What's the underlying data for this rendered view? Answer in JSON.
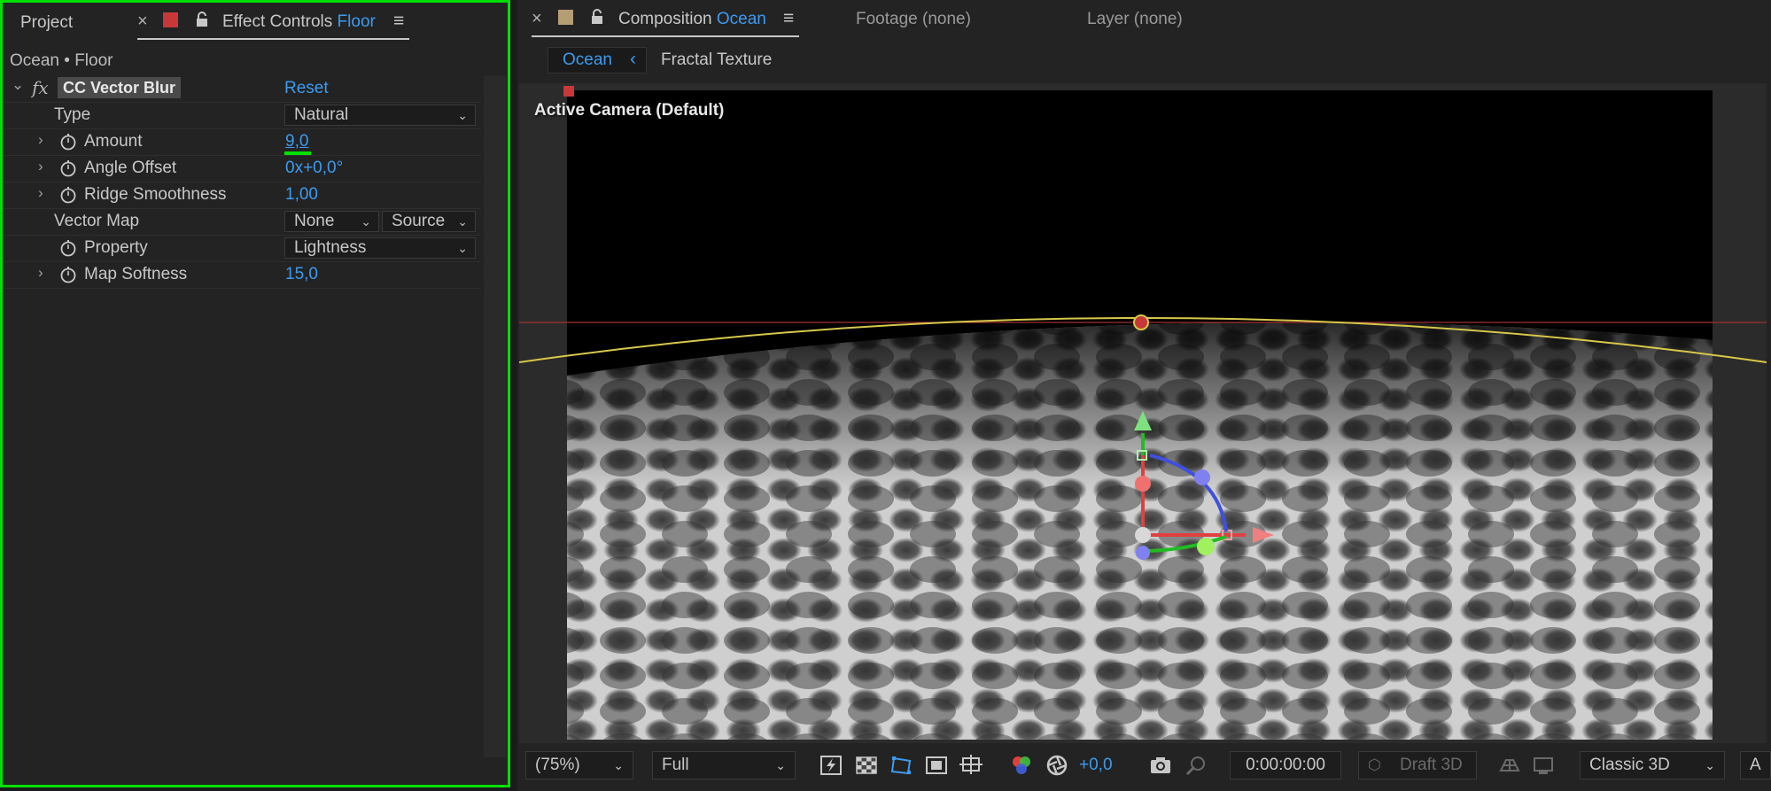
{
  "left_tabs": {
    "project": "Project",
    "close": "×",
    "effect_controls": "Effect Controls",
    "effect_layer": "Floor",
    "menu": "≡"
  },
  "breadcrumb": "Ocean • Floor",
  "effect": {
    "name": "CC Vector Blur",
    "reset": "Reset",
    "fx": "fx",
    "params": {
      "type_label": "Type",
      "type_value": "Natural",
      "amount_label": "Amount",
      "amount_value": "9,0",
      "angle_label": "Angle Offset",
      "angle_value": "0x+0,0°",
      "ridge_label": "Ridge Smoothness",
      "ridge_value": "1,00",
      "vector_map_label": "Vector Map",
      "vector_map_value": "None",
      "vector_map_source": "Source",
      "property_label": "Property",
      "property_value": "Lightness",
      "softness_label": "Map Softness",
      "softness_value": "15,0"
    }
  },
  "comp_tabs": {
    "close": "×",
    "composition": "Composition",
    "comp_name": "Ocean",
    "menu": "≡",
    "footage": "Footage (none)",
    "layer": "Layer (none)"
  },
  "nav_tabs": {
    "ocean": "Ocean",
    "back": "‹",
    "fractal": "Fractal Texture"
  },
  "viewer": {
    "camera_label": "Active Camera (Default)"
  },
  "toolbar": {
    "zoom": "(75%)",
    "resolution": "Full",
    "exposure": "+0,0",
    "timecode": "0:00:00:00",
    "draft3d": "Draft 3D",
    "renderer": "Classic 3D",
    "edge": "A"
  },
  "colors": {
    "accent_blue": "#3d9bf0",
    "highlight_green": "#00e000",
    "label_red": "#c8383a",
    "label_tan": "#b59d74"
  }
}
